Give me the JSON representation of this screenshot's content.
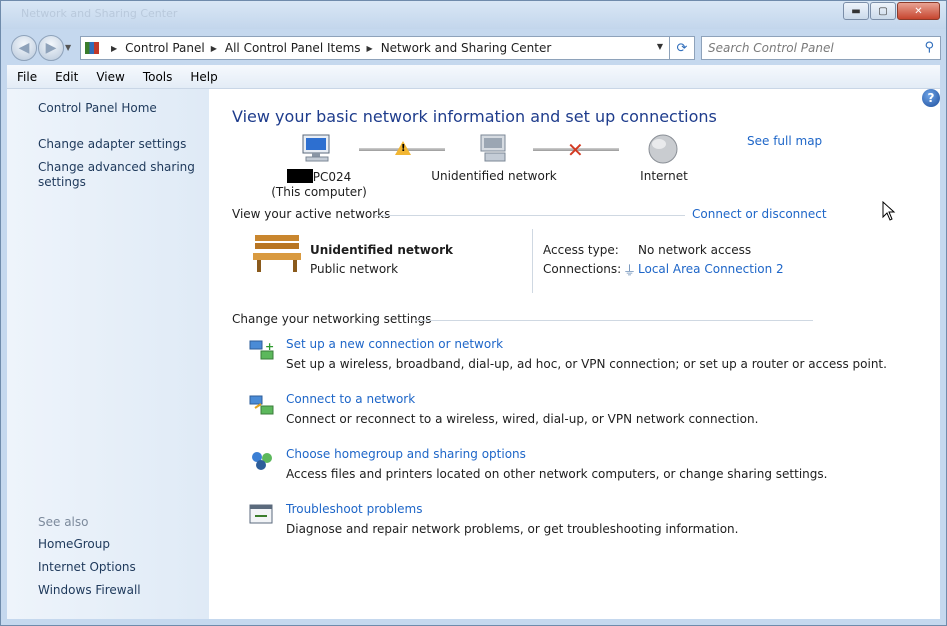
{
  "window": {
    "title": "Network and Sharing Center",
    "controls": {
      "minimize": "▬",
      "maximize": "▢",
      "close": "✕"
    }
  },
  "address_bar": {
    "breadcrumbs": [
      "Control Panel",
      "All Control Panel Items",
      "Network and Sharing Center"
    ],
    "search_placeholder": "Search Control Panel"
  },
  "menu": [
    "File",
    "Edit",
    "View",
    "Tools",
    "Help"
  ],
  "sidebar": {
    "top_links": [
      "Control Panel Home",
      "Change adapter settings",
      "Change advanced sharing settings"
    ],
    "see_also_label": "See also",
    "see_also_links": [
      "HomeGroup",
      "Internet Options",
      "Windows Firewall"
    ]
  },
  "main": {
    "title": "View your basic network information and set up connections",
    "see_full_map": "See full map",
    "map": {
      "computer_name": "PC024",
      "computer_sub": "(This computer)",
      "network_label": "Unidentified network",
      "internet_label": "Internet"
    },
    "active_networks": {
      "header": "View your active networks",
      "connect_link": "Connect or disconnect",
      "name": "Unidentified network",
      "type": "Public network",
      "access_type_label": "Access type:",
      "access_type_value": "No network access",
      "connections_label": "Connections:",
      "connections_value": "Local Area Connection 2"
    },
    "settings": {
      "header": "Change your networking settings",
      "tasks": [
        {
          "link": "Set up a new connection or network",
          "desc": "Set up a wireless, broadband, dial-up, ad hoc, or VPN connection; or set up a router or access point."
        },
        {
          "link": "Connect to a network",
          "desc": "Connect or reconnect to a wireless, wired, dial-up, or VPN network connection."
        },
        {
          "link": "Choose homegroup and sharing options",
          "desc": "Access files and printers located on other network computers, or change sharing settings."
        },
        {
          "link": "Troubleshoot problems",
          "desc": "Diagnose and repair network problems, or get troubleshooting information."
        }
      ]
    }
  },
  "colors": {
    "link": "#1e66c8",
    "title": "#1e3c8c",
    "sidebar_link": "#1e395b",
    "warning": "#f2b632",
    "error": "#d33a22"
  }
}
